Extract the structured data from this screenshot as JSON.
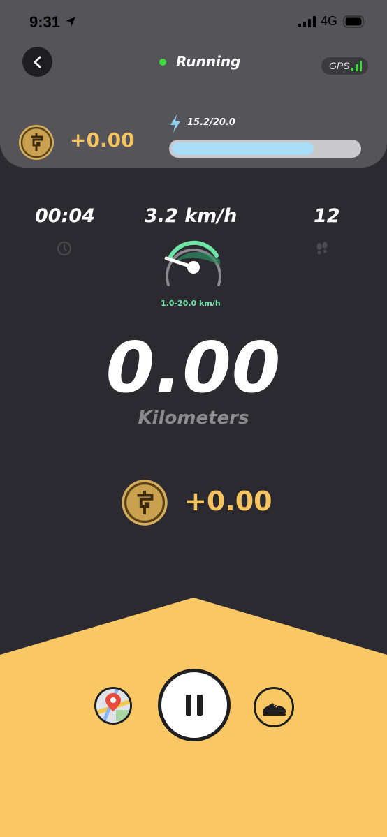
{
  "status_bar": {
    "time": "9:31",
    "network": "4G"
  },
  "header": {
    "status_label": "Running",
    "gps_label": "GPS",
    "reward": "+0.00",
    "energy_label": "15.2/20.0",
    "energy_fraction": 0.76
  },
  "stats": {
    "duration": "00:04",
    "speed": "3.2 km/h",
    "steps": "12",
    "speed_range": "1.0-20.0 km/h"
  },
  "distance": {
    "value": "0.00",
    "unit": "Kilometers"
  },
  "reward": {
    "value": "+0.00"
  },
  "colors": {
    "accent": "#f7c35f",
    "panel": "#f9c865",
    "background": "#2b2a30",
    "header": "#545459",
    "energy_fill": "#a8dcf7",
    "speed_green": "#6ee4a6",
    "running_dot": "#3ddc3d"
  },
  "icons": {
    "back": "chevron-left-icon",
    "location": "location-arrow-icon",
    "energy": "lightning-bolt-icon",
    "clock": "clock-icon",
    "steps": "footprints-icon",
    "coin": "coin-icon",
    "map": "map-pin-icon",
    "pause": "pause-icon",
    "shoe": "sneaker-icon"
  }
}
